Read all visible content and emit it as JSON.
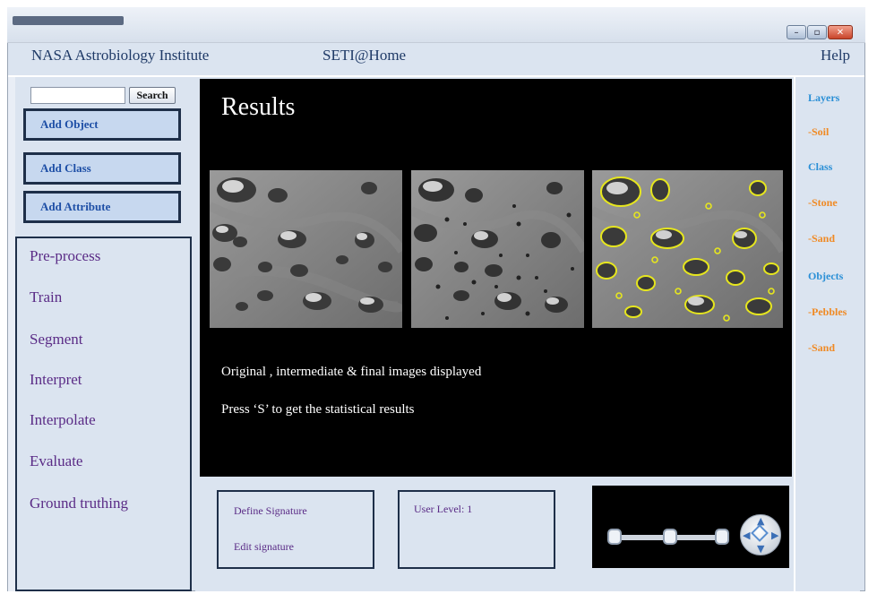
{
  "menubar": {
    "nasa": "NASA Astrobiology Institute",
    "seti": "SETI@Home",
    "help": "Help"
  },
  "window_controls": {
    "minimize": "–",
    "maximize": "▫",
    "close": "✕"
  },
  "left_panel": {
    "search_button": "Search",
    "add_object": "Add Object",
    "add_class": "Add Class",
    "add_attribute": "Add Attribute",
    "process_items": [
      "Pre-process",
      "Train",
      "Segment",
      "Interpret",
      "Interpolate",
      "Evaluate",
      "Ground truthing"
    ]
  },
  "results": {
    "title": "Results",
    "caption_1": "Original , intermediate & final images displayed",
    "caption_2": "Press ‘S’ to get the statistical results"
  },
  "bottom": {
    "define_signature": "Define Signature",
    "edit_signature": "Edit signature",
    "user_level": "User Level: 1"
  },
  "navigator": {
    "arrow_up": "▲",
    "arrow_down": "▼",
    "arrow_left": "◀",
    "arrow_right": "▶"
  },
  "right_panel": {
    "items": [
      {
        "text": "Layers",
        "kind": "heading",
        "color": "#2a8fd6"
      },
      {
        "text": "-Soil",
        "kind": "entry",
        "color": "#f08a24"
      },
      {
        "text": "Class",
        "kind": "heading",
        "color": "#2a8fd6"
      },
      {
        "text": "-Stone",
        "kind": "entry",
        "color": "#f08a24"
      },
      {
        "text": "-Sand",
        "kind": "entry",
        "color": "#f08a24"
      },
      {
        "text": "Objects",
        "kind": "heading",
        "color": "#2a8fd6"
      },
      {
        "text": "-Pebbles",
        "kind": "entry",
        "color": "#f08a24"
      },
      {
        "text": "-Sand",
        "kind": "entry",
        "color": "#f08a24"
      }
    ]
  },
  "colors": {
    "window_bg": "#dbe4f0",
    "results_bg": "#000000",
    "button_fill": "#c7d8ef",
    "button_text": "#1e4fa6",
    "process_text": "#5a2b86",
    "segmentation_outline": "#e6e61e"
  }
}
